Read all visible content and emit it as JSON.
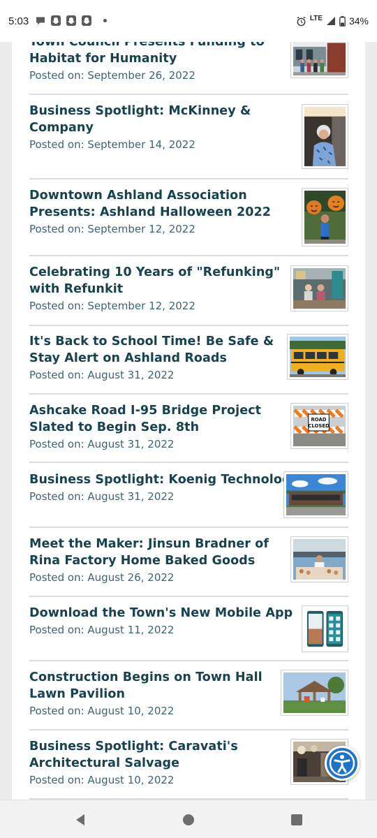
{
  "status_bar": {
    "time": "5:03",
    "network": "LTE",
    "battery": "34%",
    "icons": [
      "chat-icon",
      "snapchat-icon",
      "snapchat-icon",
      "snapchat-icon",
      "alarm-icon",
      "signal-icon",
      "battery-icon"
    ]
  },
  "news": [
    {
      "title_lines": [
        "Town Council Presents Funding to",
        "Habitat for Humanity"
      ],
      "date": "Posted on: September 26, 2022",
      "thumb": "people-storefront"
    },
    {
      "title_lines": [
        "Business Spotlight: McKinney &",
        "Company"
      ],
      "date": "Posted on: September 14, 2022",
      "thumb": "woman-portrait"
    },
    {
      "title_lines": [
        "Downtown Ashland Association",
        "Presents: Ashland Halloween 2022"
      ],
      "date": "Posted on: September 12, 2022",
      "thumb": "halloween-child"
    },
    {
      "title_lines": [
        "Celebrating 10 Years of \"Refunking\"",
        "with Refunkit"
      ],
      "date": "Posted on: September 12, 2022",
      "thumb": "shop-people"
    },
    {
      "title_lines": [
        "It's Back to School Time! Be Safe &",
        "Stay Alert on Ashland Roads"
      ],
      "date": "Posted on: August 31, 2022",
      "thumb": "school-bus"
    },
    {
      "title_lines": [
        "Ashcake Road I-95 Bridge Project",
        "Slated to Begin Sep. 8th"
      ],
      "date": "Posted on: August 31, 2022",
      "thumb": "road-closed"
    },
    {
      "title_lines": [
        "Business Spotlight: Koenig Technology"
      ],
      "date": "Posted on: August 31, 2022",
      "thumb": "office-building"
    },
    {
      "title_lines": [
        "Meet the Maker: Jinsun Bradner of",
        "Rina Factory Home Baked Goods"
      ],
      "date": "Posted on: August 26, 2022",
      "thumb": "bakery-stand"
    },
    {
      "title_lines": [
        "Download the Town's New Mobile App"
      ],
      "date": "Posted on: August 11, 2022",
      "thumb": "mobile-app"
    },
    {
      "title_lines": [
        "Construction Begins on Town Hall",
        "Lawn Pavilion"
      ],
      "date": "Posted on: August 10, 2022",
      "thumb": "pavilion"
    },
    {
      "title_lines": [
        "Business Spotlight: Caravati's",
        "Architectural Salvage"
      ],
      "date": "Posted on: August 10, 2022",
      "thumb": "salvage-shop"
    }
  ],
  "thumb_texts": {
    "road_sign": [
      "ROAD",
      "CLOSED"
    ]
  },
  "colors": {
    "title": "#17434f",
    "date": "#3f6471",
    "accessibility": "#1c73c8"
  },
  "nav": {
    "back": "back-icon",
    "home": "home-icon",
    "recents": "recents-icon"
  }
}
